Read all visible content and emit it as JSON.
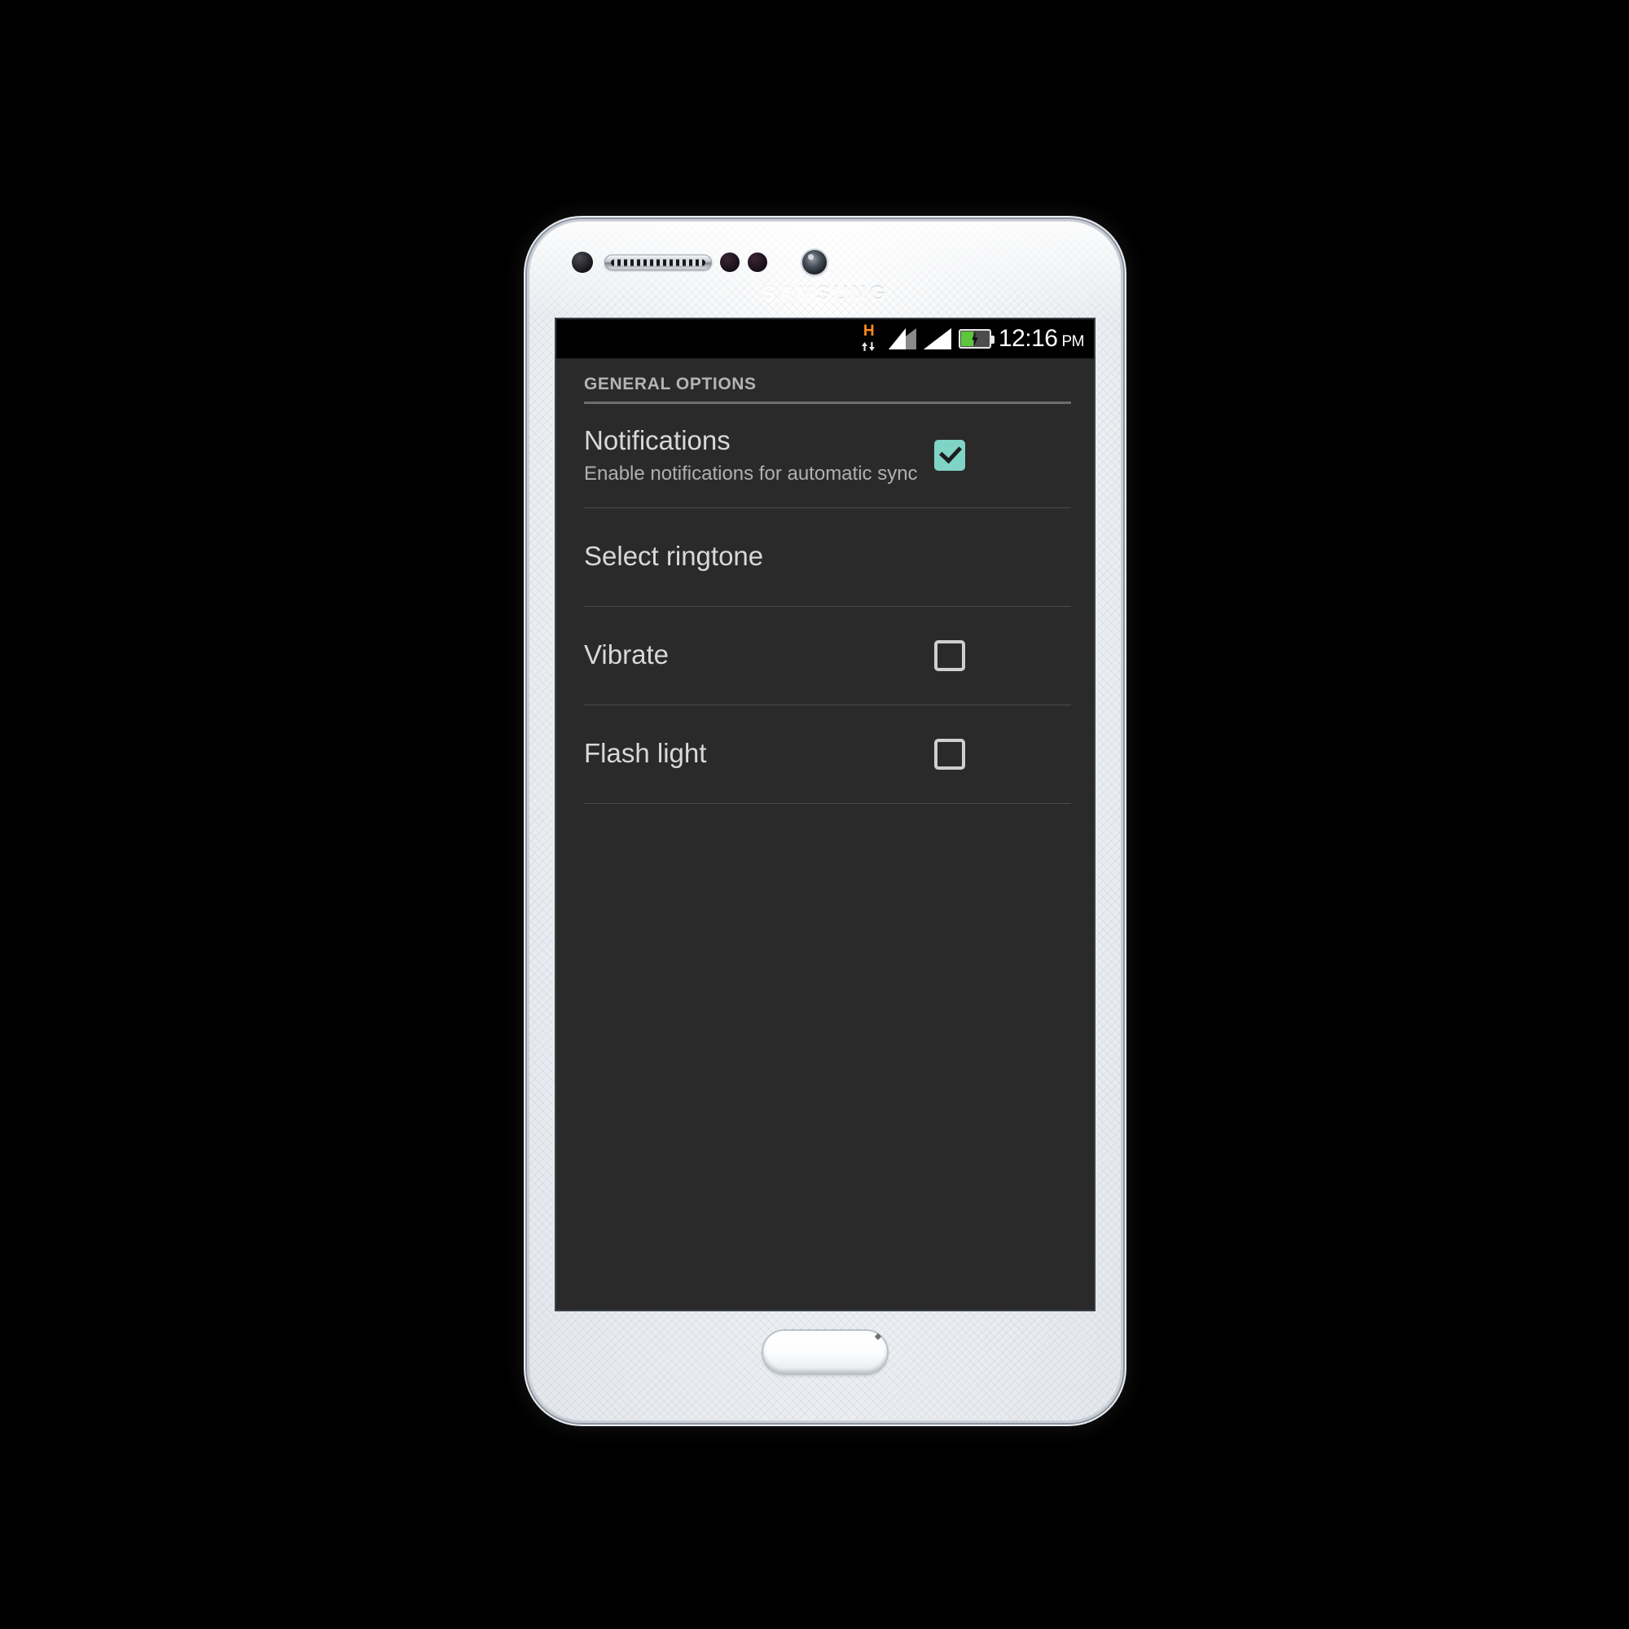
{
  "device": {
    "brand": "SAMSUNG",
    "body_color": "#eef1f5",
    "icons": {
      "proximity_sensor": "proximity-sensor-dot",
      "earpiece": "earpiece-speaker",
      "ir_sensor_left": "ir-sensor-dot",
      "ir_sensor_right": "ir-sensor-dot",
      "front_camera": "front-camera",
      "home": "home-button"
    }
  },
  "status_bar": {
    "background": "#000000",
    "network_type": "H",
    "network_color": "#ff8c1a",
    "data_arrows": "data-transfer-arrows",
    "signal_1": "signal-bars-partial",
    "signal_2": "signal-bars-full",
    "battery": "battery-charging",
    "battery_color": "#5ec63c",
    "time": "12:16",
    "am_pm": "PM"
  },
  "screen": {
    "background": "#2a2a2a",
    "accent": "#7fd4c6",
    "section": {
      "header": "GENERAL OPTIONS"
    },
    "rows": [
      {
        "title": "Notifications",
        "summary": "Enable notifications for automatic sync",
        "control": "checkbox",
        "checked": true
      },
      {
        "title": "Select ringtone",
        "summary": "",
        "control": "none",
        "checked": false
      },
      {
        "title": "Vibrate",
        "summary": "",
        "control": "checkbox",
        "checked": false
      },
      {
        "title": "Flash light",
        "summary": "",
        "control": "checkbox",
        "checked": false
      }
    ]
  }
}
